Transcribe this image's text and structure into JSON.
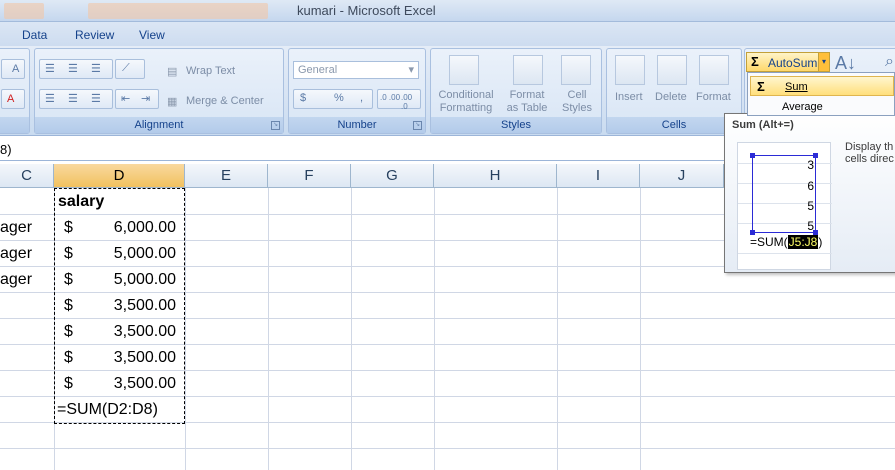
{
  "window": {
    "title": "kumari - Microsoft Excel"
  },
  "tabs": [
    "Data",
    "Review",
    "View"
  ],
  "ribbon": {
    "alignment": {
      "wrap_text": "Wrap Text",
      "merge_center": "Merge & Center",
      "label": "Alignment"
    },
    "number": {
      "format": "General",
      "currency": "$",
      "percent": "%",
      "comma": ",",
      "inc_dec": ".0 .00",
      "dec_dec": ".00 .0",
      "label": "Number"
    },
    "styles": {
      "conditional": [
        "Conditional",
        "Formatting"
      ],
      "format_table": [
        "Format",
        "as Table"
      ],
      "cell_styles": [
        "Cell",
        "Styles"
      ],
      "label": "Styles"
    },
    "cells": {
      "insert": "Insert",
      "delete": "Delete",
      "format": "Format",
      "label": "Cells"
    },
    "editing": {
      "autosum": "AutoSum"
    }
  },
  "autosum_menu": {
    "items": [
      "Sum",
      "Average"
    ]
  },
  "tooltip": {
    "title": "Sum (Alt+=)",
    "desc_line1": "Display th",
    "desc_line2": "cells direc",
    "preview_values": [
      "3",
      "6",
      "5",
      "5"
    ],
    "preview_formula_prefix": "=SUM(",
    "preview_range": "J5:J8",
    "preview_formula_suffix": ")"
  },
  "formula_bar": {
    "text": "8)"
  },
  "grid": {
    "columns": [
      "C",
      "D",
      "E",
      "F",
      "G",
      "H",
      "I",
      "J"
    ],
    "header_d": "salary",
    "col_c": [
      "ager",
      "ager",
      "ager"
    ],
    "currency_symbol": "$",
    "salaries": [
      "6,000.00",
      "5,000.00",
      "5,000.00",
      "3,500.00",
      "3,500.00",
      "3,500.00",
      "3,500.00"
    ],
    "formula_cell": "=SUM(D2:D8)"
  }
}
